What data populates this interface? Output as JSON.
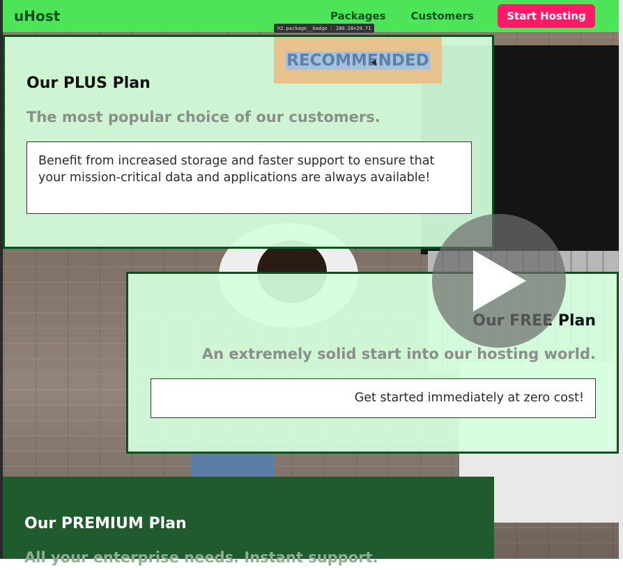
{
  "header": {
    "logo": "uHost",
    "nav": [
      {
        "label": "Packages"
      },
      {
        "label": "Customers"
      }
    ],
    "cta_label": "Start Hosting"
  },
  "devtools_tooltip": {
    "selector": "h2.package__badge",
    "size": "280.28×29.71"
  },
  "plans": {
    "plus": {
      "badge": "RECOMMENDED",
      "title": "Our PLUS Plan",
      "subtitle": "The most popular choice of our customers.",
      "description": "Benefit from increased storage and faster support to ensure that your mission-critical data and applications are always available!"
    },
    "free": {
      "title": "Our FREE Plan",
      "subtitle": "An extremely solid start into our hosting world.",
      "description": "Get started immediately at zero cost!"
    },
    "premium": {
      "title": "Our PREMIUM Plan",
      "subtitle": "All your enterprise needs. Instant support."
    }
  },
  "colors": {
    "header_bg": "#4ee45a",
    "brand_dark": "#0e4f1f",
    "cta_bg": "#ff1b68",
    "card_bg": "#d5ffdc",
    "premium_bg": "#1f5b2c",
    "badge_bg": "#e8c48c"
  },
  "icons": {
    "video_overlay": "play-icon"
  }
}
